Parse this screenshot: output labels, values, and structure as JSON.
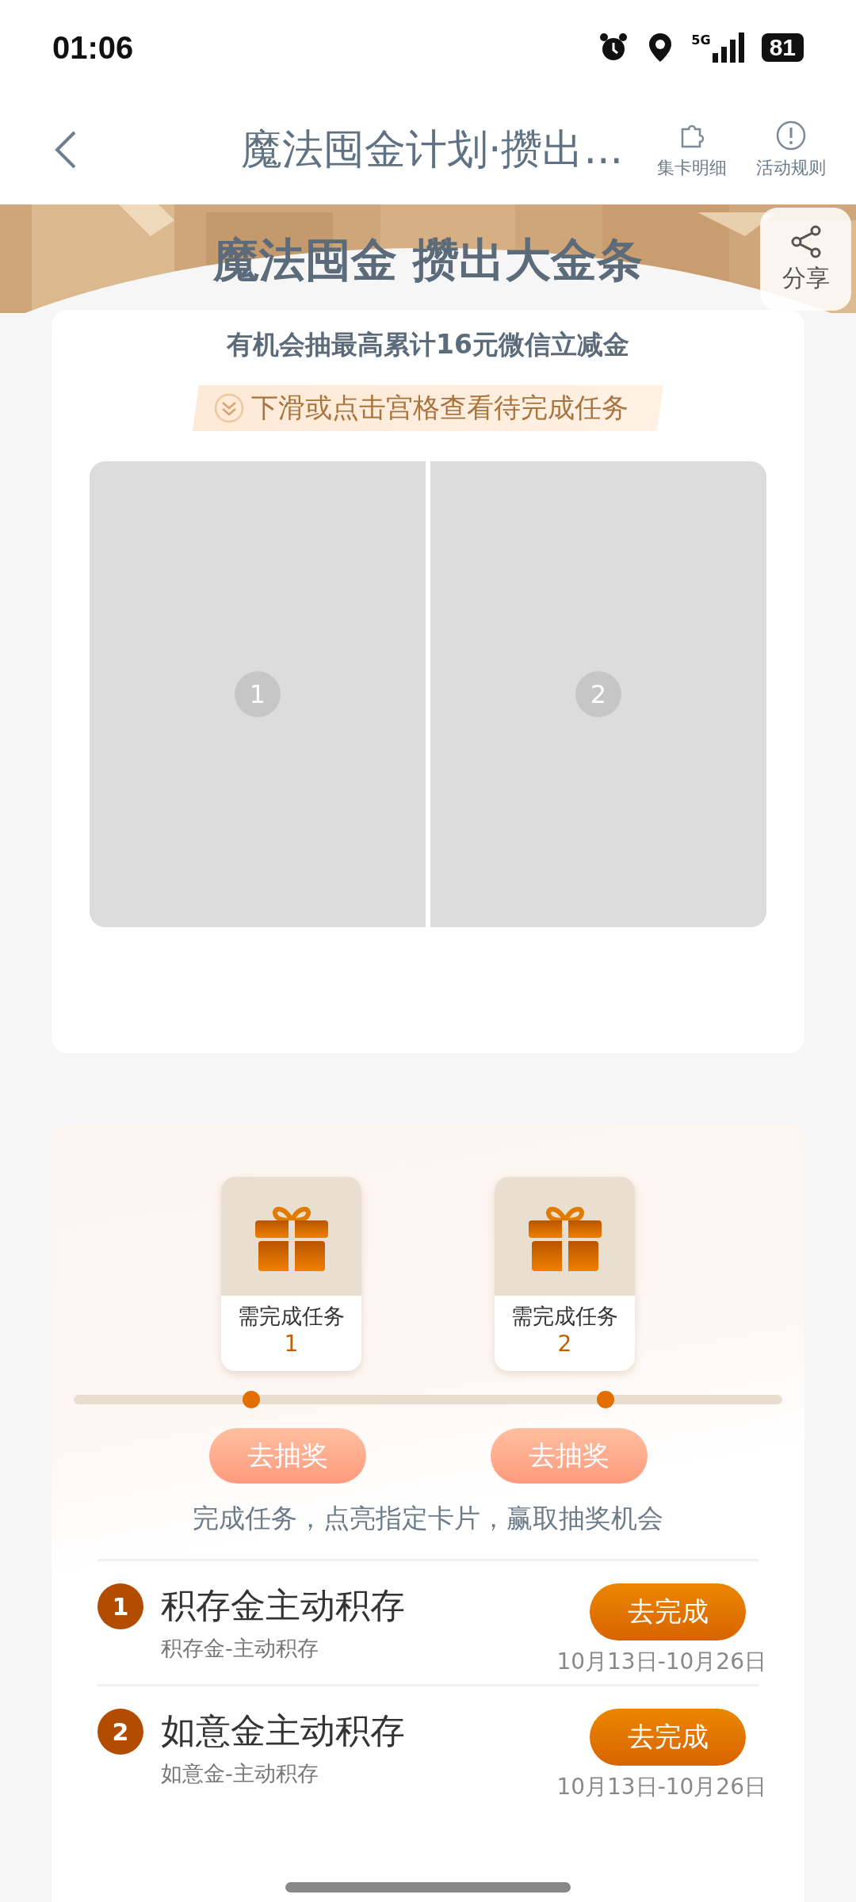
{
  "status_bar": {
    "time": "01:06",
    "network": "5G",
    "battery": "81"
  },
  "nav": {
    "title": "魔法囤金计划·攒出...",
    "actions": [
      {
        "label": "集卡明细",
        "kind": "puzzle"
      },
      {
        "label": "活动规则",
        "kind": "info"
      }
    ]
  },
  "banner": {
    "headline": "魔法囤金 攒出大金条",
    "share": "分享"
  },
  "card_grid": {
    "subtitle": "有机会抽最高累计16元微信立减金",
    "hint": "下滑或点击宫格查看待完成任务",
    "cells": [
      {
        "number": "1"
      },
      {
        "number": "2"
      }
    ]
  },
  "rewards": {
    "milestones": [
      {
        "label": "需完成任务",
        "count": "1",
        "button": "去抽奖"
      },
      {
        "label": "需完成任务",
        "count": "2",
        "button": "去抽奖"
      }
    ],
    "caption": "完成任务，点亮指定卡片，赢取抽奖机会"
  },
  "tasks": [
    {
      "number": "1",
      "title": "积存金主动积存",
      "subtitle": "积存金-主动积存",
      "button": "去完成",
      "dates": "10月13日-10月26日"
    },
    {
      "number": "2",
      "title": "如意金主动积存",
      "subtitle": "如意金-主动积存",
      "button": "去完成",
      "dates": "10月13日-10月26日"
    }
  ]
}
